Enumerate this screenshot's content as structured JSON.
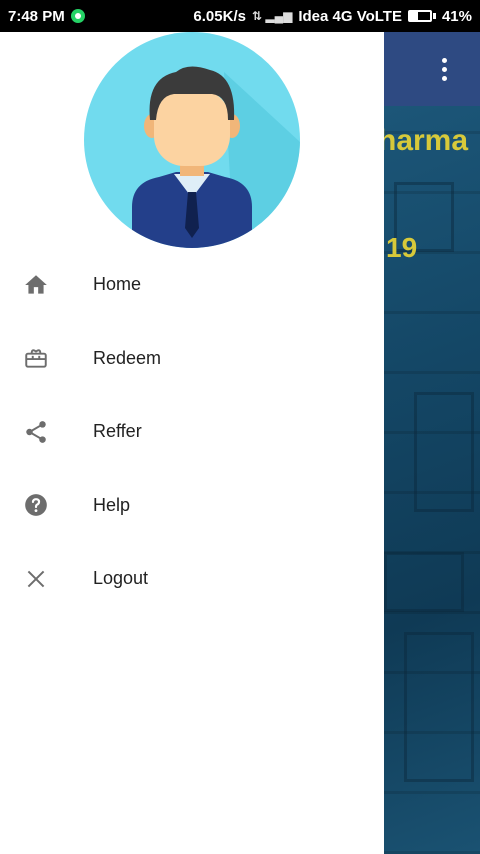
{
  "status_bar": {
    "time": "7:48 PM",
    "speed": "6.05K/s",
    "carrier": "Idea 4G VoLTE",
    "battery": "41%",
    "battery_level": 0.41
  },
  "background_app": {
    "title_fragment": "harma",
    "date_fragment": "19"
  },
  "drawer": {
    "menu": [
      {
        "label": "Home",
        "icon": "home-icon"
      },
      {
        "label": "Redeem",
        "icon": "gift-card-icon"
      },
      {
        "label": "Reffer",
        "icon": "share-icon"
      },
      {
        "label": "Help",
        "icon": "help-icon"
      },
      {
        "label": "Logout",
        "icon": "close-icon"
      }
    ]
  },
  "colors": {
    "avatar_bg": "#71dbee",
    "toolbar": "#2e4a82",
    "accent_text": "#d7c93a",
    "icon_gray": "#6d6d6d"
  }
}
